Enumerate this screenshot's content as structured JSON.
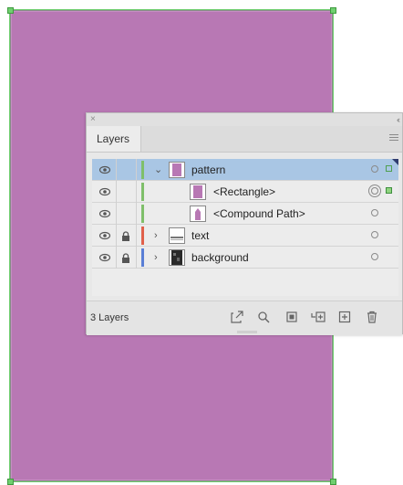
{
  "artboard": {
    "fill_color": "#b878b4",
    "selection_color": "#6fcf6f"
  },
  "layers_panel": {
    "close_glyph": "×",
    "collapse_glyph": "‹‹",
    "tab_label": "Layers",
    "menu_icon": "hamburger-icon",
    "layers": [
      {
        "name": "pattern",
        "visible": true,
        "locked": false,
        "expanded": true,
        "level": 0,
        "color": "#7fbf6a",
        "selected": true,
        "thumbnail_color": "#b878b4"
      },
      {
        "name": "<Rectangle>",
        "visible": true,
        "locked": false,
        "level": 1,
        "color": "#7fbf6a",
        "selected": false,
        "thumbnail_color": "#b878b4",
        "object_selected": true
      },
      {
        "name": "<Compound Path>",
        "visible": true,
        "locked": false,
        "level": 1,
        "color": "#7fbf6a",
        "selected": false,
        "thumbnail_color": "#b878b4"
      },
      {
        "name": "text",
        "visible": true,
        "locked": true,
        "expanded": false,
        "level": 0,
        "color": "#e0604a",
        "selected": false
      },
      {
        "name": "background",
        "visible": true,
        "locked": true,
        "expanded": false,
        "level": 0,
        "color": "#5a7fd6",
        "selected": false
      }
    ],
    "footer": {
      "layer_count": "3 Layers",
      "buttons": [
        "export-icon",
        "search-icon",
        "clipping-mask-icon",
        "new-sublayer-icon",
        "new-layer-icon",
        "trash-icon"
      ]
    }
  }
}
